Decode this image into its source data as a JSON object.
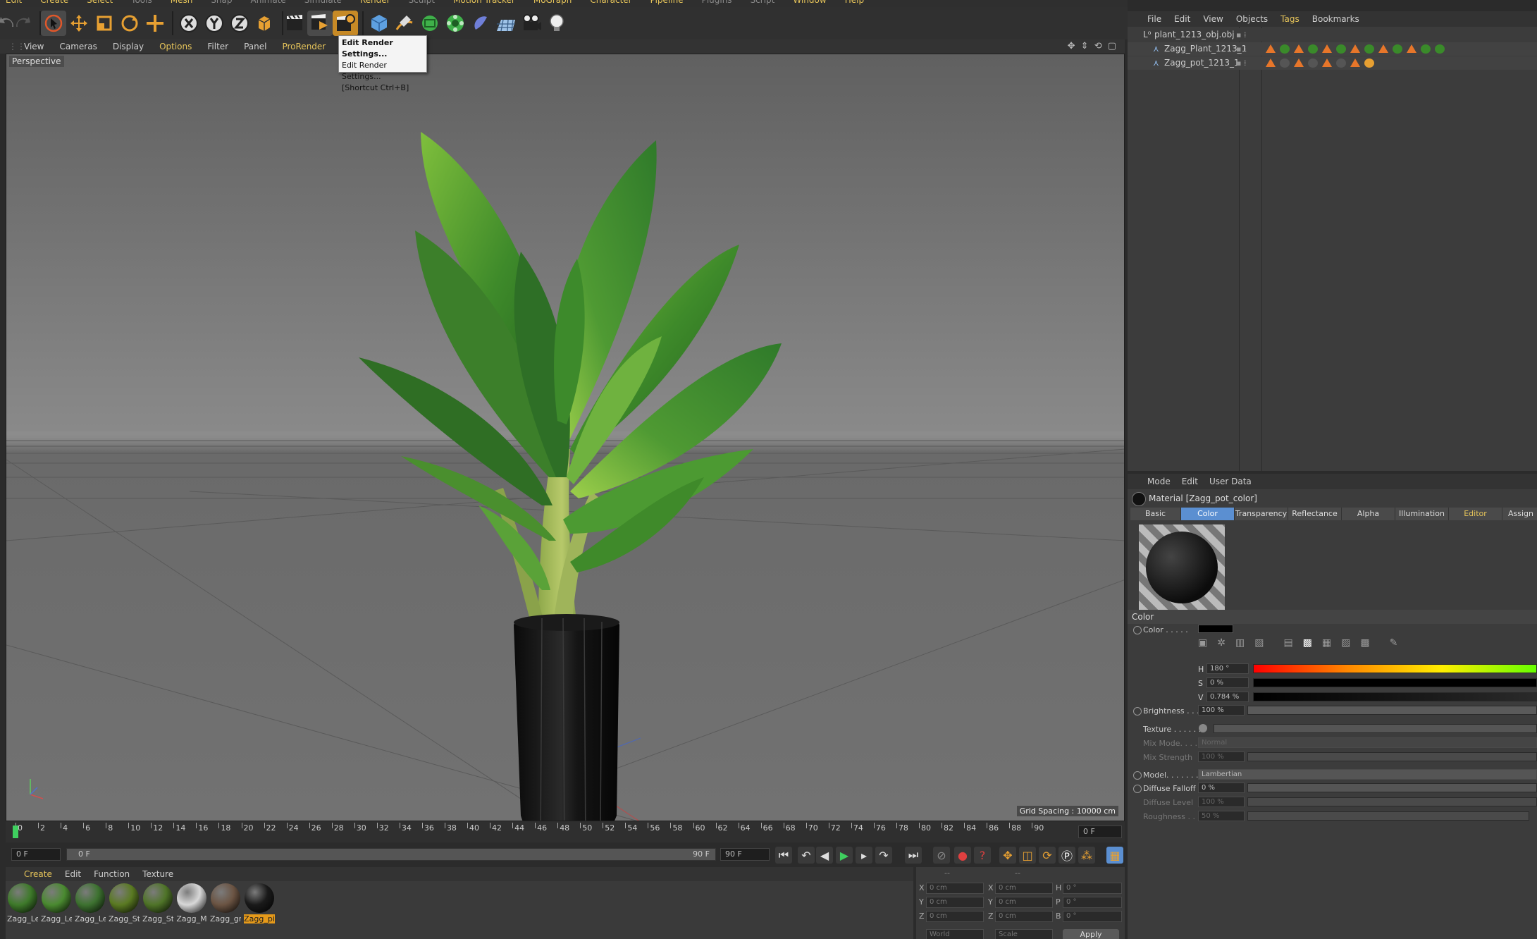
{
  "menubar": [
    "Edit",
    "Create",
    "Select",
    "Tools",
    "Mesh",
    "Snap",
    "Animate",
    "Simulate",
    "Render",
    "Sculpt",
    "Motion Tracker",
    "MoGraph",
    "Character",
    "Pipeline",
    "Plugins",
    "Script",
    "Window",
    "Help"
  ],
  "toolbar_icons": [
    "undo-icon",
    "redo-icon",
    "selection-icon",
    "move-icon",
    "scale-icon",
    "rotate-icon",
    "add-icon",
    "x-axis-icon",
    "y-axis-icon",
    "z-axis-icon",
    "coordinate-system-icon",
    "render-view-icon",
    "render-to-picture-viewer-icon",
    "edit-render-settings-icon",
    "cube-icon",
    "pen-icon",
    "subdivision-icon",
    "cloner-icon",
    "deformer-icon",
    "floor-icon",
    "camera-icon",
    "light-icon"
  ],
  "dropdown": {
    "item1": "Edit Render Settings...",
    "item2": "Edit Render Settings...",
    "item3": "[Shortcut Ctrl+B]"
  },
  "viewport_menu": [
    "View",
    "Cameras",
    "Display",
    "Options",
    "Filter",
    "Panel",
    "ProRender"
  ],
  "viewport": {
    "label": "Perspective",
    "grid_spacing": "Grid Spacing : 10000 cm"
  },
  "timeline": {
    "ticks": [
      "0",
      "2",
      "4",
      "6",
      "8",
      "10",
      "12",
      "14",
      "16",
      "18",
      "20",
      "22",
      "24",
      "26",
      "28",
      "30",
      "32",
      "34",
      "36",
      "38",
      "40",
      "42",
      "44",
      "46",
      "48",
      "50",
      "52",
      "54",
      "56",
      "58",
      "60",
      "62",
      "64",
      "66",
      "68",
      "70",
      "72",
      "74",
      "76",
      "78",
      "80",
      "82",
      "84",
      "86",
      "88",
      "90"
    ],
    "current_frame": "0 F",
    "start_field": "0 F",
    "range_start": "0 F",
    "range_end": "90 F",
    "end_field": "90 F"
  },
  "material_manager": {
    "menu": [
      "Create",
      "Edit",
      "Function",
      "Texture"
    ],
    "materials": [
      {
        "name": "Zagg_Le",
        "color": "#3e7a2a"
      },
      {
        "name": "Zagg_Le",
        "color": "#4a8a30"
      },
      {
        "name": "Zagg_Le",
        "color": "#3d7230"
      },
      {
        "name": "Zagg_St",
        "color": "#5a7a22"
      },
      {
        "name": "Zagg_St",
        "color": "#4f7428"
      },
      {
        "name": "Zagg_M",
        "color": "#d8d8d8"
      },
      {
        "name": "Zagg_gr",
        "color": "#6b5443"
      },
      {
        "name": "Zagg_pi",
        "color": "#1a1a1a"
      }
    ]
  },
  "coordinates": {
    "header": "--",
    "rows": [
      {
        "a": "X",
        "av": "0 cm",
        "b": "X",
        "bv": "0 cm",
        "c": "H",
        "cv": "0 °"
      },
      {
        "a": "Y",
        "av": "0 cm",
        "b": "Y",
        "bv": "0 cm",
        "c": "P",
        "cv": "0 °"
      },
      {
        "a": "Z",
        "av": "0 cm",
        "b": "Z",
        "bv": "0 cm",
        "c": "B",
        "cv": "0 °"
      }
    ],
    "world": "World",
    "scale": "Scale",
    "apply": "Apply"
  },
  "object_manager": {
    "menu": [
      "File",
      "Edit",
      "View",
      "Objects",
      "Tags",
      "Bookmarks"
    ],
    "objects": [
      {
        "name": "plant_1213_obj.obj",
        "indent": 0
      },
      {
        "name": "Zagg_Plant_1213_1",
        "indent": 1
      },
      {
        "name": "Zagg_pot_1213_1",
        "indent": 1
      }
    ]
  },
  "attribute_manager": {
    "menu": [
      "Mode",
      "Edit",
      "User Data"
    ],
    "title": "Material [Zagg_pot_color]",
    "tabs": [
      "Basic",
      "Color",
      "Transparency",
      "Reflectance",
      "Alpha",
      "Illumination",
      "Editor",
      "Assign"
    ],
    "section": "Color",
    "color_label": "Color . . . . .",
    "h_label": "H",
    "h_value": "180 °",
    "s_label": "S",
    "s_value": "0 %",
    "v_label": "V",
    "v_value": "0.784 %",
    "brightness_label": "Brightness . . .",
    "brightness_value": "100 %",
    "texture_label": "Texture . . . . . .",
    "mixmode_label": "Mix Mode. . . . .",
    "mixmode_value": "Normal",
    "mixstrength_label": "Mix Strength",
    "mixstrength_value": "100 %",
    "model_label": "Model. . . . . . .",
    "model_value": "Lambertian",
    "diffuse_falloff_label": "Diffuse Falloff",
    "diffuse_falloff_value": "0 %",
    "diffuse_level_label": "Diffuse Level",
    "diffuse_level_value": "100 %",
    "roughness_label": "Roughness . . .",
    "roughness_value": "50 %"
  }
}
